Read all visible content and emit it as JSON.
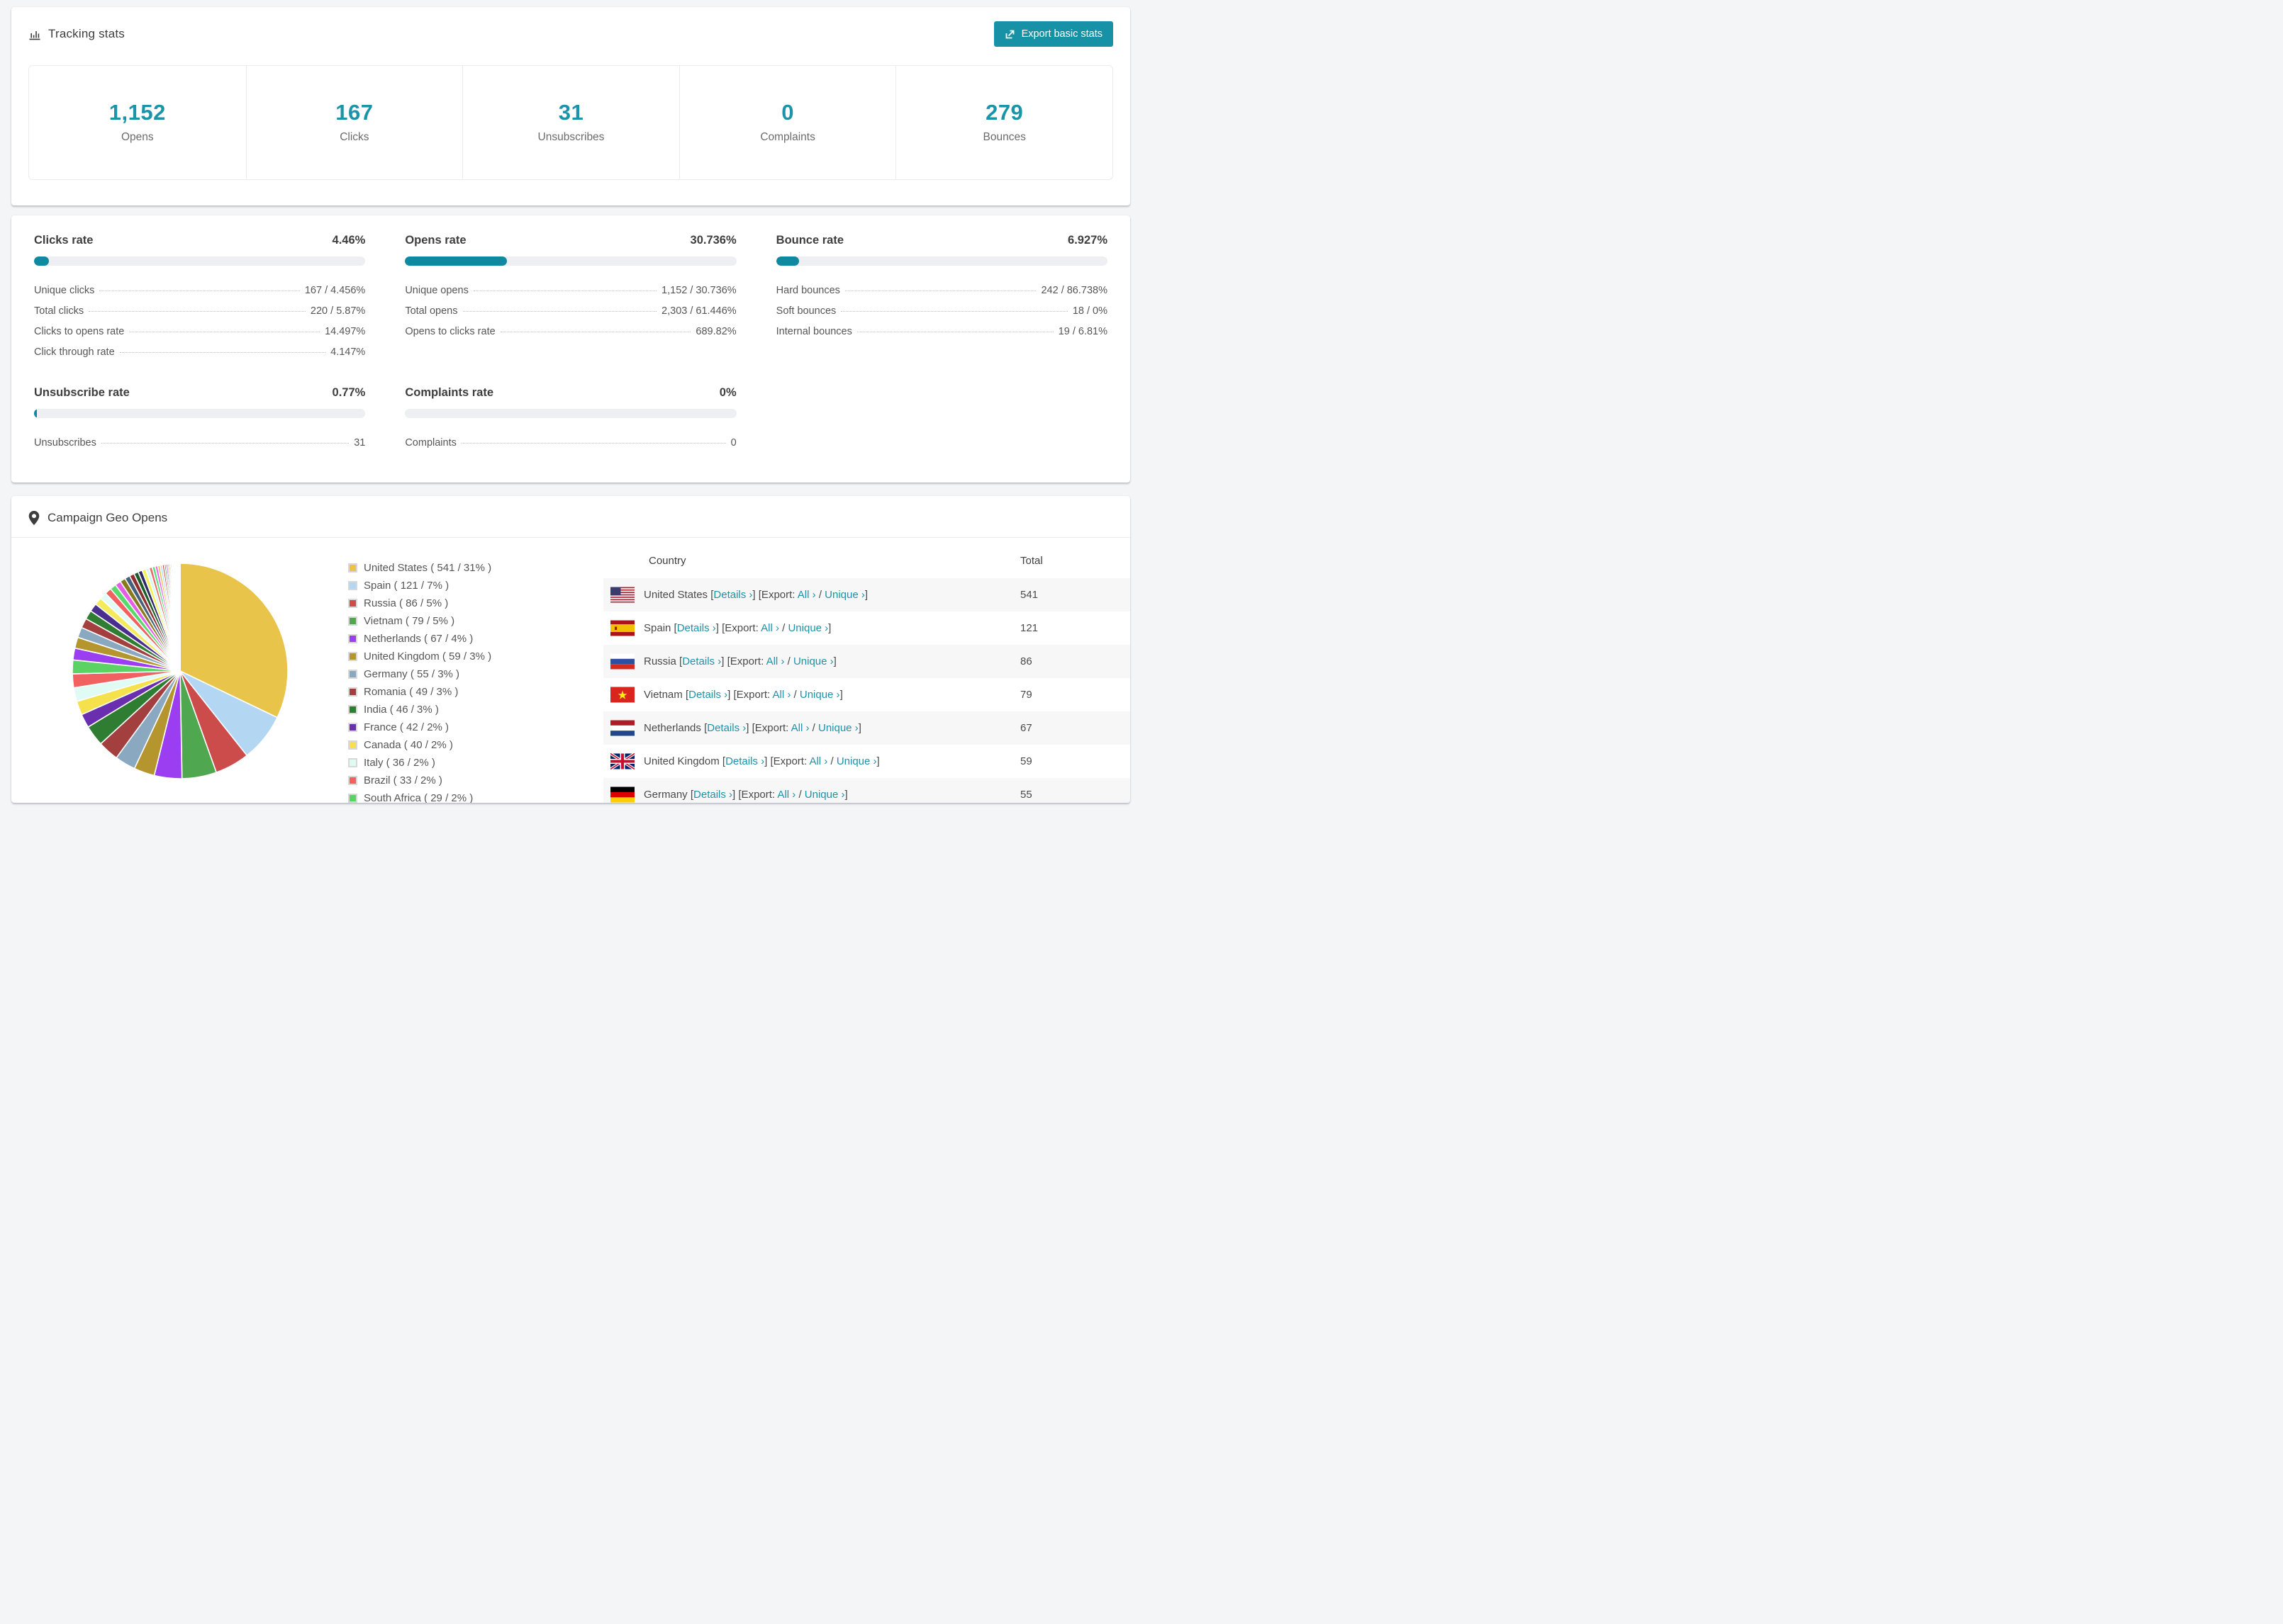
{
  "accent": "#1791a6",
  "tracking": {
    "title": "Tracking stats",
    "export_label": "Export basic stats",
    "stats": [
      {
        "value": "1,152",
        "label": "Opens"
      },
      {
        "value": "167",
        "label": "Clicks"
      },
      {
        "value": "31",
        "label": "Unsubscribes"
      },
      {
        "value": "0",
        "label": "Complaints"
      },
      {
        "value": "279",
        "label": "Bounces"
      }
    ]
  },
  "rates": [
    {
      "title": "Clicks rate",
      "value": "4.46%",
      "percent": 4.46,
      "rows": [
        {
          "label": "Unique clicks",
          "value": "167 / 4.456%"
        },
        {
          "label": "Total clicks",
          "value": "220 / 5.87%"
        },
        {
          "label": "Clicks to opens rate",
          "value": "14.497%"
        },
        {
          "label": "Click through rate",
          "value": "4.147%"
        }
      ]
    },
    {
      "title": "Opens rate",
      "value": "30.736%",
      "percent": 30.736,
      "rows": [
        {
          "label": "Unique opens",
          "value": "1,152 / 30.736%"
        },
        {
          "label": "Total opens",
          "value": "2,303 / 61.446%"
        },
        {
          "label": "Opens to clicks rate",
          "value": "689.82%"
        }
      ]
    },
    {
      "title": "Bounce rate",
      "value": "6.927%",
      "percent": 6.927,
      "rows": [
        {
          "label": "Hard bounces",
          "value": "242 / 86.738%"
        },
        {
          "label": "Soft bounces",
          "value": "18 / 0%"
        },
        {
          "label": "Internal bounces",
          "value": "19 / 6.81%"
        }
      ]
    },
    {
      "title": "Unsubscribe rate",
      "value": "0.77%",
      "percent": 0.77,
      "rows": [
        {
          "label": "Unsubscribes",
          "value": "31"
        }
      ]
    },
    {
      "title": "Complaints rate",
      "value": "0%",
      "percent": 0,
      "rows": [
        {
          "label": "Complaints",
          "value": "0"
        }
      ]
    }
  ],
  "geo": {
    "title": "Campaign Geo Opens",
    "columns": {
      "country": "Country",
      "total": "Total"
    },
    "links": {
      "lb": "[",
      "rb": "]",
      "details": "Details ›",
      "export": "[Export:",
      "all": "All ›",
      "slash": "/",
      "unique": "Unique ›"
    },
    "rows": [
      {
        "country": "United States",
        "total": "541"
      },
      {
        "country": "Spain",
        "total": "121"
      },
      {
        "country": "Russia",
        "total": "86"
      },
      {
        "country": "Vietnam",
        "total": "79"
      },
      {
        "country": "Netherlands",
        "total": "67"
      },
      {
        "country": "United Kingdom",
        "total": "59"
      },
      {
        "country": "Germany",
        "total": "55"
      }
    ]
  },
  "chart_data": {
    "type": "pie",
    "title": "Campaign Geo Opens",
    "legend_position": "right",
    "slices": [
      {
        "label": "United States",
        "value": 541,
        "pct": 31,
        "color": "#e8c44a"
      },
      {
        "label": "Spain",
        "value": 121,
        "pct": 7,
        "color": "#b3d7f2"
      },
      {
        "label": "Russia",
        "value": 86,
        "pct": 5,
        "color": "#cc4c4c"
      },
      {
        "label": "Vietnam",
        "value": 79,
        "pct": 5,
        "color": "#4fa84f"
      },
      {
        "label": "Netherlands",
        "value": 67,
        "pct": 4,
        "color": "#9b3df0"
      },
      {
        "label": "United Kingdom",
        "value": 59,
        "pct": 3,
        "color": "#b5952e"
      },
      {
        "label": "Germany",
        "value": 55,
        "pct": 3,
        "color": "#8aa9c0"
      },
      {
        "label": "Romania",
        "value": 49,
        "pct": 3,
        "color": "#a33f3f"
      },
      {
        "label": "India",
        "value": 46,
        "pct": 3,
        "color": "#2e7d32"
      },
      {
        "label": "France",
        "value": 42,
        "pct": 2,
        "color": "#6a2fae"
      },
      {
        "label": "Canada",
        "value": 40,
        "pct": 2,
        "color": "#f5e14b"
      },
      {
        "label": "Italy",
        "value": 36,
        "pct": 2,
        "color": "#dffbf4"
      },
      {
        "label": "Brazil",
        "value": 33,
        "pct": 2,
        "color": "#f26161"
      },
      {
        "label": "South Africa",
        "value": 29,
        "pct": 2,
        "color": "#5bd364"
      }
    ],
    "other_slices_pct": [
      1.7,
      1.6,
      1.5,
      1.4,
      1.3,
      1.2,
      1.1,
      1.0,
      0.95,
      0.9,
      0.85,
      0.8,
      0.75,
      0.7,
      0.65,
      0.6,
      0.55,
      0.5,
      0.46,
      0.42,
      0.38,
      0.35,
      0.32,
      0.29,
      0.26,
      0.24,
      0.22,
      0.2,
      0.18,
      0.16,
      0.14,
      0.12,
      0.11,
      0.1,
      0.09,
      0.08,
      0.07,
      0.06,
      0.05,
      0.045,
      0.04,
      0.035,
      0.03,
      0.025,
      0.02
    ],
    "other_palette": [
      "#9b3df0",
      "#b5952e",
      "#8aa9c0",
      "#a33f3f",
      "#2e7d32",
      "#4a2f8f",
      "#f5e95c",
      "#e3fbf6",
      "#f26161",
      "#57d96b",
      "#e45fe4",
      "#8a7a1e",
      "#46627a",
      "#8f2f2f",
      "#1e5c2a",
      "#2d2a66",
      "#f3ef55",
      "#d6f7f0",
      "#ef6b6b",
      "#54e07e",
      "#ef5def",
      "#e8c44a",
      "#b3d7f2",
      "#cc4c4c",
      "#4fa84f"
    ]
  }
}
